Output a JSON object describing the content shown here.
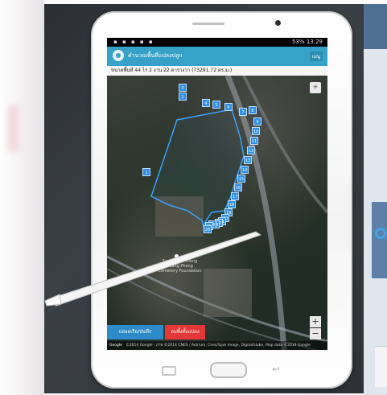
{
  "status_bar": {
    "time": "13:29",
    "battery": "53%"
  },
  "app": {
    "title": "คำนวณพื้นที่แปลงปลูก",
    "action_label": "เมนู",
    "area_info": "ขนาดพื้นที่ 44 ไร่ 2 งาน 22 ตารางวา (73291.72 ตร.ม.)"
  },
  "map": {
    "place_label": "Sung Thae Thong Ruang Phong Cemetery Foundation",
    "point_labels": [
      "3",
      "2",
      "4",
      "5",
      "6",
      "7",
      "8",
      "9",
      "10",
      "11",
      "12",
      "13",
      "14",
      "15",
      "16",
      "17",
      "18",
      "19",
      "20",
      "21",
      "22",
      "23",
      "24",
      "25",
      "26",
      "1"
    ],
    "attribution": "©2014 Google - ภาพ ©2014 CNES / Astrium, Cnes/Spot Image, DigitalGlobe, Map data ©2014 Google",
    "google_logo": "Google"
  },
  "buttons": {
    "share_label": "ปล่อยเรือ/บันทึก",
    "delete_label": "ลบทิ้งทั้งแปลง"
  },
  "colors": {
    "appbar": "#37a2c7",
    "polygon_stroke": "#3aa3ff",
    "share_button": "#2e8bc9",
    "delete_button": "#e43838"
  }
}
